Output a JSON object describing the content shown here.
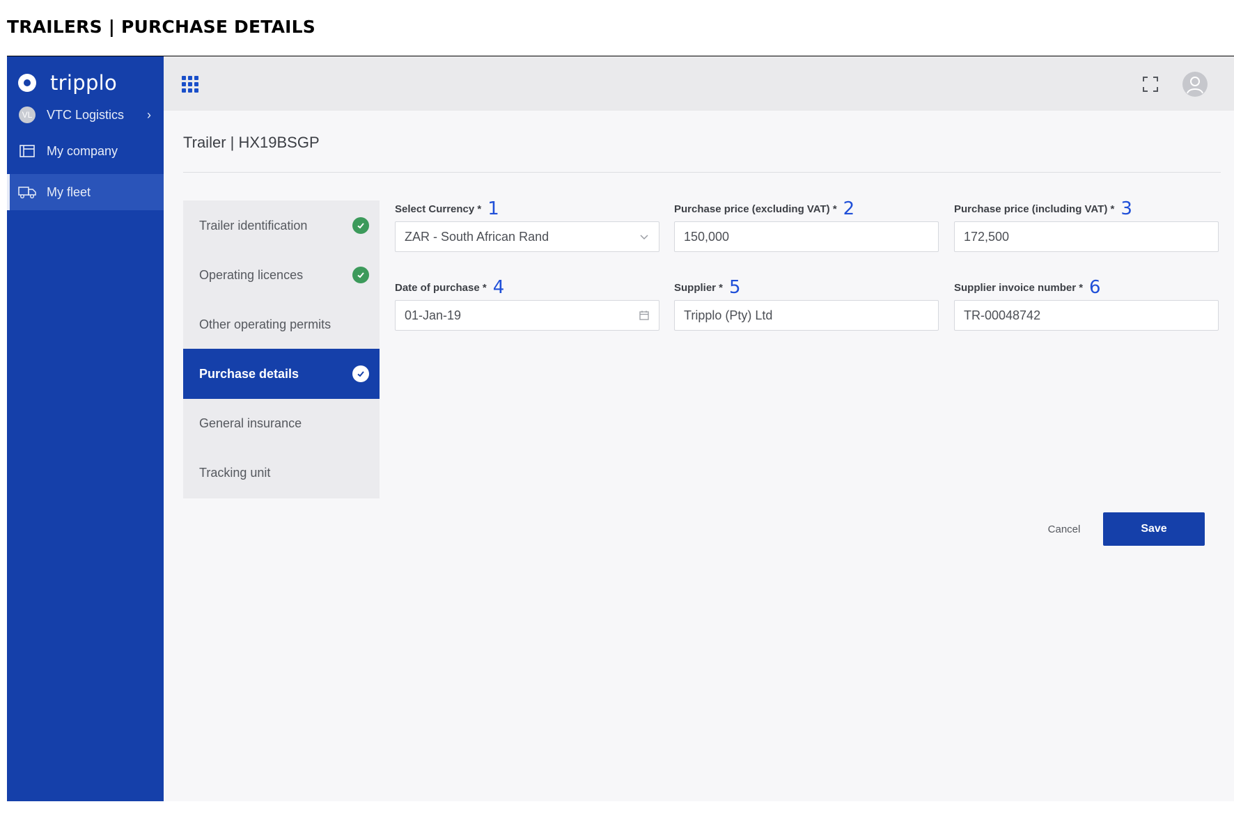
{
  "doc_title": "TRAILERS | PURCHASE DETAILS",
  "brand": {
    "name": "tripplo"
  },
  "sidebar": {
    "company": {
      "initials": "VL",
      "label": "VTC Logistics"
    },
    "items": [
      {
        "label": "My company",
        "icon": "company-icon"
      },
      {
        "label": "My fleet",
        "icon": "truck-icon",
        "active": true
      }
    ]
  },
  "topbar": {
    "apps_icon": "grid-icon",
    "fullscreen_icon": "fullscreen-icon",
    "user_icon": "user-avatar-icon"
  },
  "page": {
    "title": "Trailer | HX19BSGP"
  },
  "steps": [
    {
      "label": "Trailer identification",
      "completed": true,
      "active": false
    },
    {
      "label": "Operating licences",
      "completed": true,
      "active": false
    },
    {
      "label": "Other operating permits",
      "completed": false,
      "active": false
    },
    {
      "label": "Purchase details",
      "completed": true,
      "active": true
    },
    {
      "label": "General insurance",
      "completed": false,
      "active": false
    },
    {
      "label": "Tracking unit",
      "completed": false,
      "active": false
    }
  ],
  "form": {
    "currency": {
      "label": "Select Currency *",
      "marker": "1",
      "value": "ZAR - South African Rand"
    },
    "price_excl": {
      "label": "Purchase price (excluding VAT) *",
      "marker": "2",
      "value": "150,000"
    },
    "price_incl": {
      "label": "Purchase price (including VAT) *",
      "marker": "3",
      "value": "172,500"
    },
    "date": {
      "label": "Date of purchase *",
      "marker": "4",
      "value": "01-Jan-19"
    },
    "supplier": {
      "label": "Supplier *",
      "marker": "5",
      "value": "Tripplo (Pty) Ltd"
    },
    "invoice": {
      "label": "Supplier invoice number *",
      "marker": "6",
      "value": "TR-00048742"
    }
  },
  "actions": {
    "cancel": "Cancel",
    "save": "Save"
  },
  "colors": {
    "brand_blue": "#1540aa",
    "success_green": "#3c9a5b",
    "annotation_blue": "#1f4fd8"
  }
}
